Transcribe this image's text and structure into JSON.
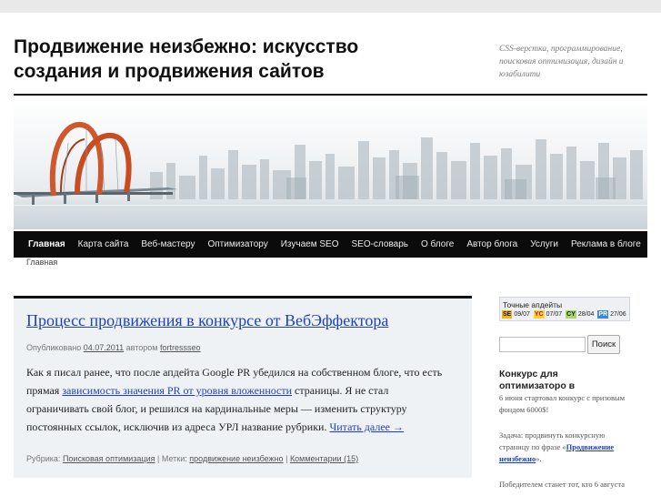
{
  "site": {
    "title_line1": "Продвижение неизбежно: искусство",
    "title_line2": "создания и продвижения сайтов",
    "description": "CSS-верстка, программирование, поисковая оптимизация, дизайн и юзабилити"
  },
  "nav": {
    "items": [
      {
        "label": "Главная",
        "active": true
      },
      {
        "label": "Карта сайта"
      },
      {
        "label": "Веб-мастеру"
      },
      {
        "label": "Оптимизатору"
      },
      {
        "label": "Изучаем SEO"
      },
      {
        "label": "SEO-словарь"
      },
      {
        "label": "О блоге"
      },
      {
        "label": "Автор блога"
      },
      {
        "label": "Услуги"
      },
      {
        "label": "Реклама в блоге"
      }
    ]
  },
  "breadcrumb": "Главная",
  "post": {
    "title": "Процесс продвижения в конкурсе от ВебЭффектора",
    "meta_prefix": "Опубликовано",
    "date": "04.07.2011",
    "meta_author_prefix": "автором",
    "author": "fortressseo",
    "body_p1": "Как я писал ранее, что после апдейта Google PR убедился на собственном блоге, что есть прямая ",
    "body_link": "зависимость значения PR от уровня вложенности",
    "body_p2": " страницы. Я не стал ограничивать свой блог, и решился на кардинальные меры — изменить структуру постоянных ссылок, исключив из адреса УРЛ название рубрики. ",
    "read_more": "Читать далее →",
    "footer_category_prefix": "Рубрика:",
    "category": "Поисковая оптимизация",
    "footer_tags_prefix": "Метки:",
    "tag": "продвижение неизбежно",
    "comments": "Комментарии (15)"
  },
  "updates": {
    "title": "Точные апдейты",
    "items": [
      {
        "label": "SE",
        "value": "09/07",
        "bg": "#f2b705",
        "fg": "#1a1a1a"
      },
      {
        "label": "YC",
        "value": "07/07",
        "bg": "#f6d23c",
        "fg": "#c0111f"
      },
      {
        "label": "CY",
        "value": "28/04",
        "bg": "#a6d86a",
        "fg": "#1a1a1a"
      },
      {
        "label": "PR",
        "value": "27/06",
        "bg": "#3a86e0",
        "fg": "#ffffff"
      }
    ]
  },
  "search": {
    "placeholder": "",
    "button_label": "Поиск"
  },
  "widget": {
    "title": "Конкурс для оптимизаторо в",
    "para1": "6 июня стартовал конкурс с призовым фондом 6000$!",
    "para2_prefix": "Задача: продвинуть конкурсную страницу по фразе «",
    "para2_link": "Продвижение неизбежно",
    "para2_suffix": "».",
    "para3": "Победителем станет тот, кто 6 августа"
  },
  "colors": {
    "link": "#1e3fc3",
    "nav_bg": "#0b0b0b",
    "post_bg": "#eef2f5"
  }
}
